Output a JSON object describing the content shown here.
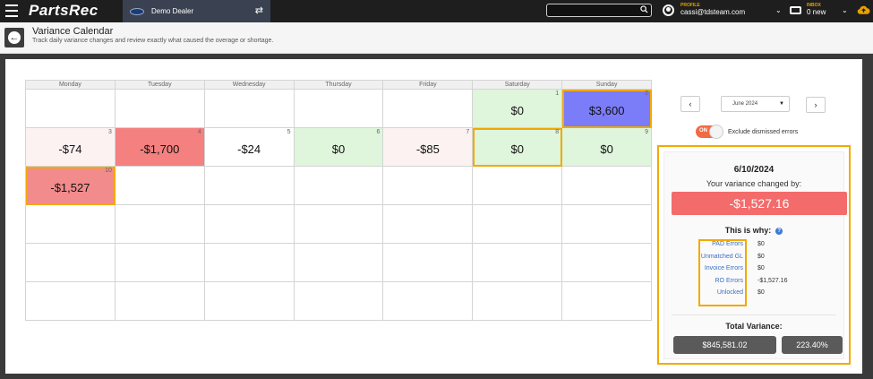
{
  "app": {
    "logo": "PartsRec",
    "dealer": "Demo Dealer"
  },
  "search": {
    "placeholder": ""
  },
  "profile": {
    "label": "PROFILE",
    "email": "cassi@tdsteam.com"
  },
  "inbox": {
    "label": "INBOX",
    "count": "0 new"
  },
  "page": {
    "title": "Variance Calendar",
    "subtitle": "Track daily variance changes and review exactly what caused the overage or shortage."
  },
  "calendar": {
    "weekdays": [
      "Monday",
      "Tuesday",
      "Wednesday",
      "Thursday",
      "Friday",
      "Saturday",
      "Sunday"
    ],
    "rows": [
      [
        {
          "day": "",
          "value": "",
          "style": ""
        },
        {
          "day": "",
          "value": "",
          "style": ""
        },
        {
          "day": "",
          "value": "",
          "style": ""
        },
        {
          "day": "",
          "value": "",
          "style": ""
        },
        {
          "day": "",
          "value": "",
          "style": ""
        },
        {
          "day": "1",
          "value": "$0",
          "style": "green"
        },
        {
          "day": "2",
          "value": "$3,600",
          "style": "blue sel"
        }
      ],
      [
        {
          "day": "3",
          "value": "-$74",
          "style": "pink"
        },
        {
          "day": "4",
          "value": "-$1,700",
          "style": "red"
        },
        {
          "day": "5",
          "value": "-$24",
          "style": ""
        },
        {
          "day": "6",
          "value": "$0",
          "style": "green"
        },
        {
          "day": "7",
          "value": "-$85",
          "style": "pink"
        },
        {
          "day": "8",
          "value": "$0",
          "style": "green sel"
        },
        {
          "day": "9",
          "value": "$0",
          "style": "green"
        }
      ],
      [
        {
          "day": "10",
          "value": "-$1,527",
          "style": "red2 sel"
        },
        {
          "day": "",
          "value": "",
          "style": ""
        },
        {
          "day": "",
          "value": "",
          "style": ""
        },
        {
          "day": "",
          "value": "",
          "style": ""
        },
        {
          "day": "",
          "value": "",
          "style": ""
        },
        {
          "day": "",
          "value": "",
          "style": ""
        },
        {
          "day": "",
          "value": "",
          "style": ""
        }
      ],
      [
        {
          "day": "",
          "value": "",
          "style": ""
        },
        {
          "day": "",
          "value": "",
          "style": ""
        },
        {
          "day": "",
          "value": "",
          "style": ""
        },
        {
          "day": "",
          "value": "",
          "style": ""
        },
        {
          "day": "",
          "value": "",
          "style": ""
        },
        {
          "day": "",
          "value": "",
          "style": ""
        },
        {
          "day": "",
          "value": "",
          "style": ""
        }
      ],
      [
        {
          "day": "",
          "value": "",
          "style": ""
        },
        {
          "day": "",
          "value": "",
          "style": ""
        },
        {
          "day": "",
          "value": "",
          "style": ""
        },
        {
          "day": "",
          "value": "",
          "style": ""
        },
        {
          "day": "",
          "value": "",
          "style": ""
        },
        {
          "day": "",
          "value": "",
          "style": ""
        },
        {
          "day": "",
          "value": "",
          "style": ""
        }
      ],
      [
        {
          "day": "",
          "value": "",
          "style": ""
        },
        {
          "day": "",
          "value": "",
          "style": ""
        },
        {
          "day": "",
          "value": "",
          "style": ""
        },
        {
          "day": "",
          "value": "",
          "style": ""
        },
        {
          "day": "",
          "value": "",
          "style": ""
        },
        {
          "day": "",
          "value": "",
          "style": ""
        },
        {
          "day": "",
          "value": "",
          "style": ""
        }
      ]
    ]
  },
  "controls": {
    "prev": "‹",
    "next": "›",
    "month": "June 2024",
    "toggle_state": "ON",
    "toggle_label": "Exclude dismissed errors"
  },
  "detail": {
    "date": "6/10/2024",
    "changed_label": "Your variance changed by:",
    "amount": "-$1,527.16",
    "why_label": "This is why:",
    "errors": [
      {
        "label": "PAD Errors",
        "value": "$0"
      },
      {
        "label": "Unmatched GL",
        "value": "$0"
      },
      {
        "label": "Invoice Errors",
        "value": "$0"
      },
      {
        "label": "RO Errors",
        "value": "-$1,527.16"
      },
      {
        "label": "Unlocked",
        "value": "$0"
      }
    ],
    "total_label": "Total Variance:",
    "total_value": "$845,581.02",
    "total_percent": "223.40%"
  },
  "colors": {
    "accent": "#f2a900",
    "negative": "#f46b6b",
    "positive_bg": "#dff5dc",
    "highlight_blue": "#7b7cf8",
    "toggle_on": "#f06a45"
  }
}
